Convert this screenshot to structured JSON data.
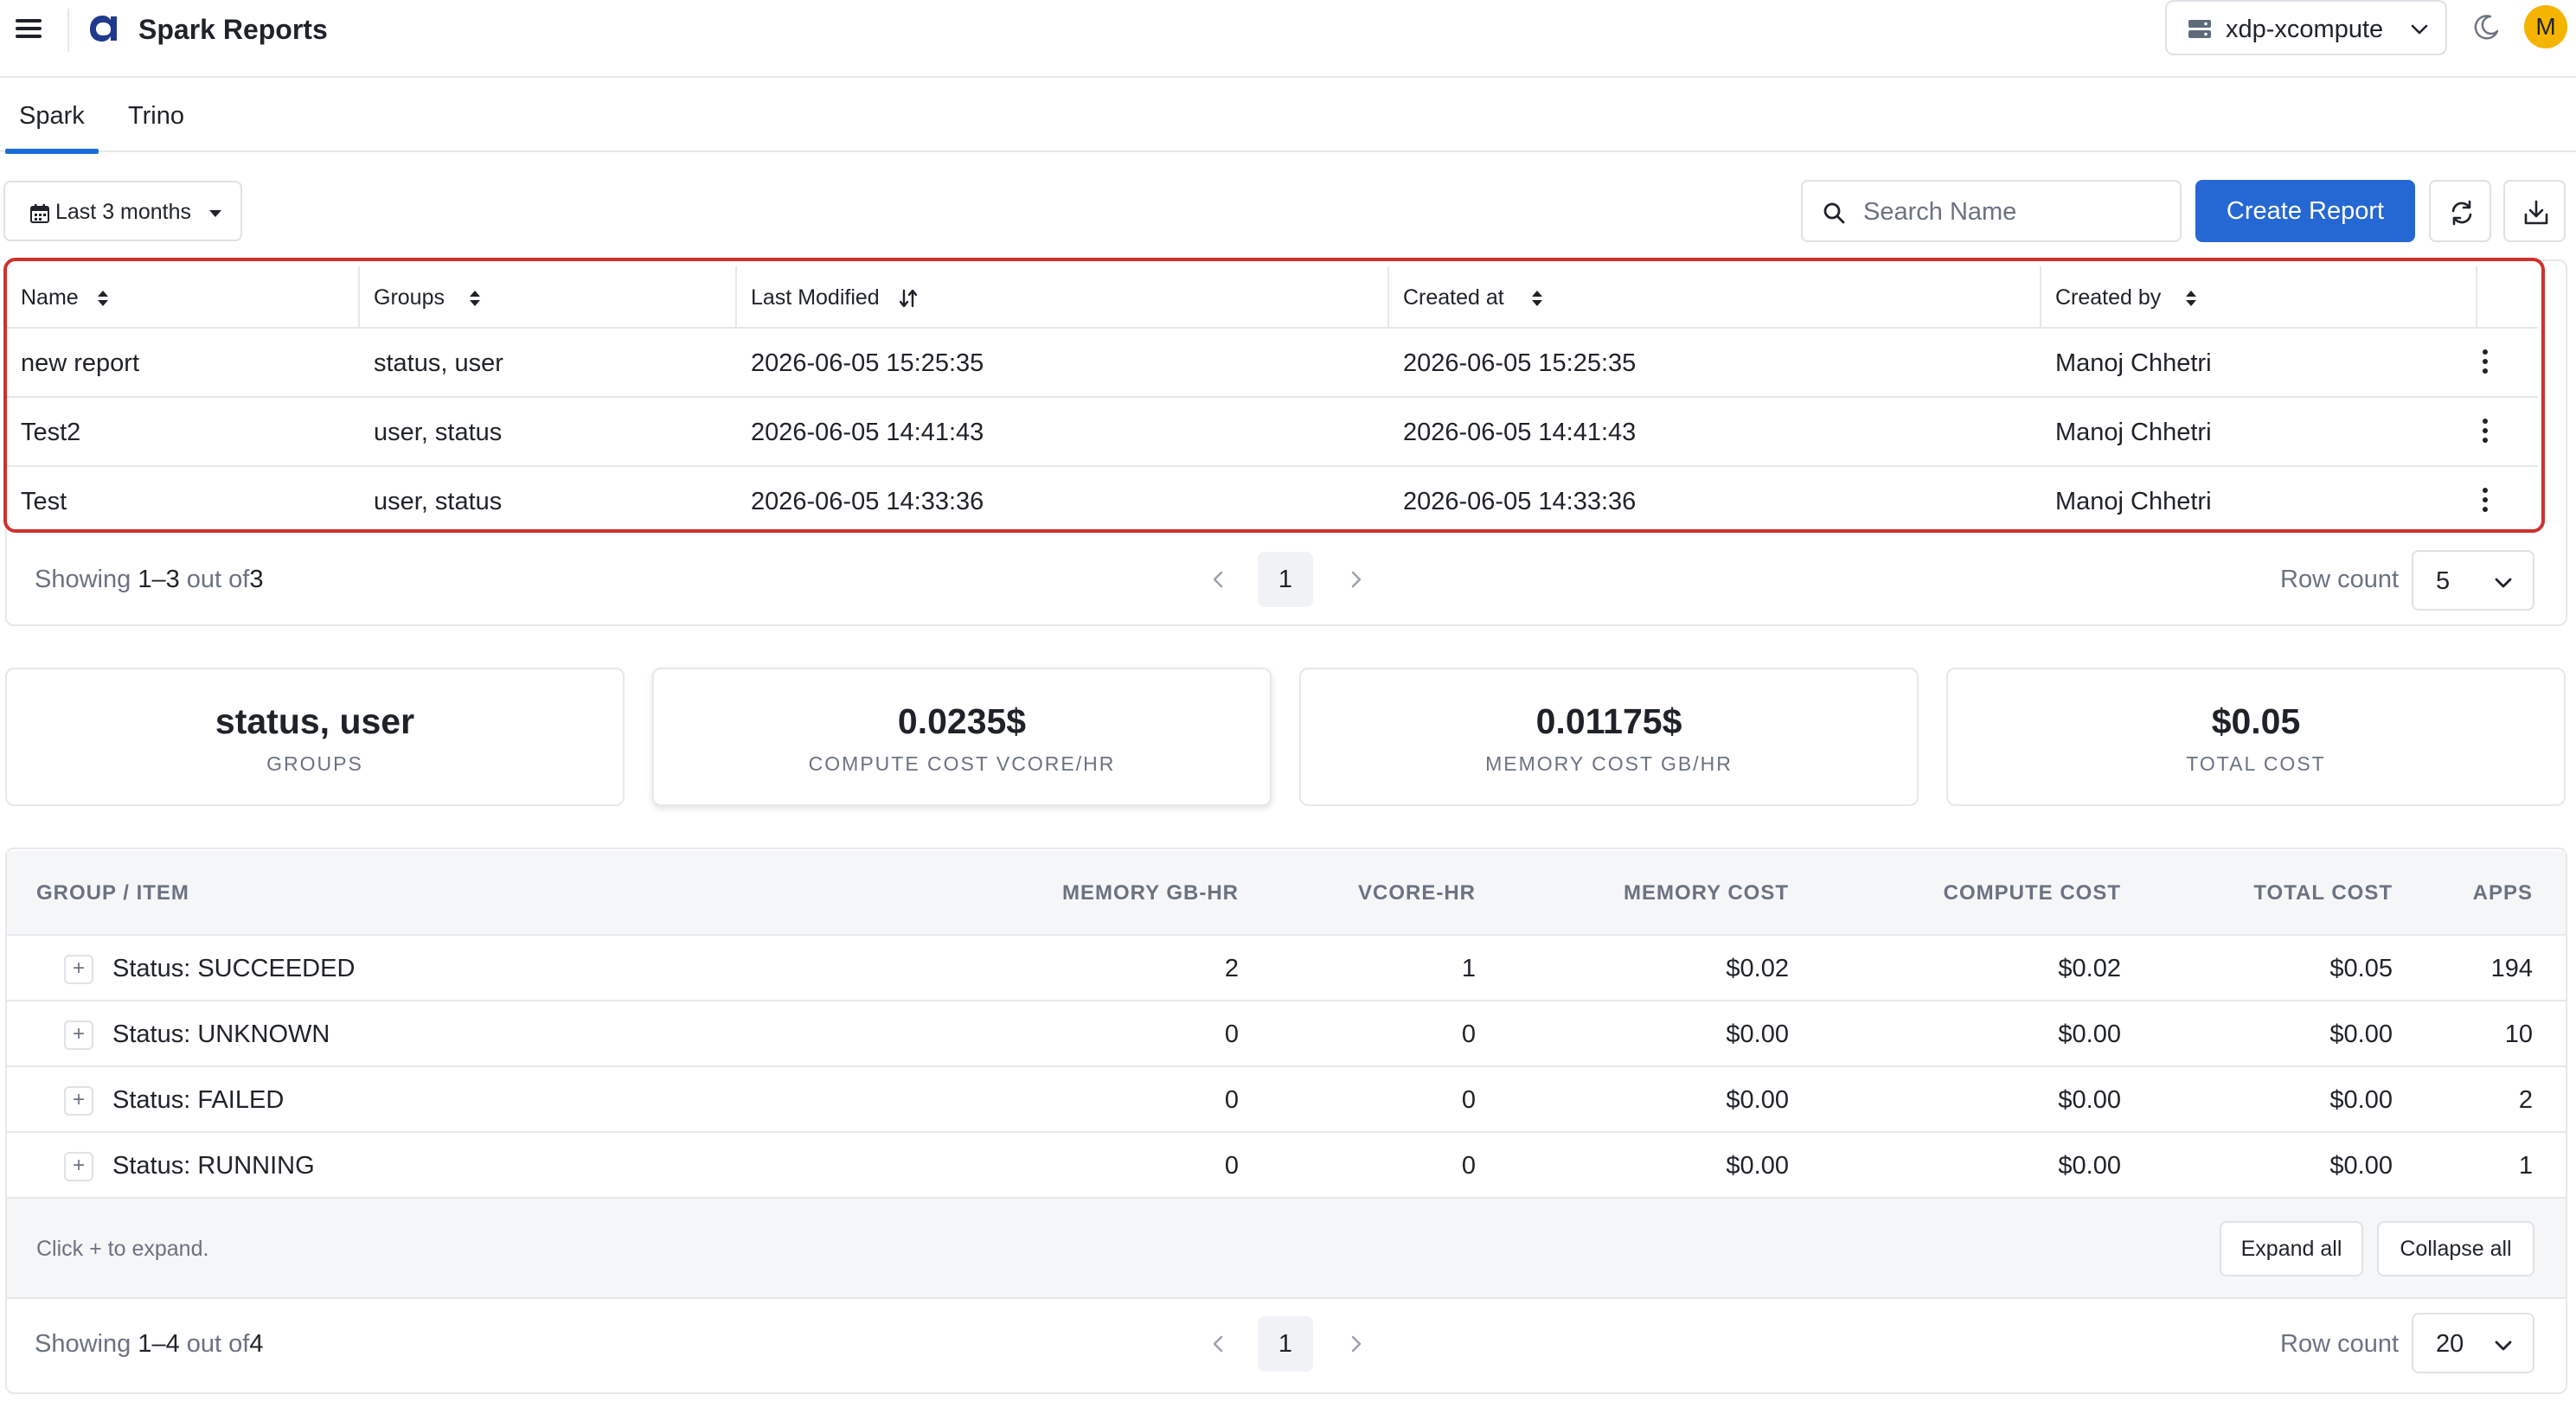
{
  "header": {
    "app_title": "Spark Reports",
    "cluster": "xdp-xcompute",
    "avatar_initial": "M",
    "brand_color": "#2568d3"
  },
  "tabs": [
    {
      "label": "Spark",
      "active": true
    },
    {
      "label": "Trino",
      "active": false
    }
  ],
  "toolbar": {
    "date_range": "Last 3 months",
    "search_placeholder": "Search Name",
    "create_label": "Create Report",
    "refresh_icon": "refresh-icon",
    "download_icon": "download-icon"
  },
  "reports": {
    "columns": [
      "Name",
      "Groups",
      "Last Modified",
      "Created at",
      "Created by"
    ],
    "rows": [
      {
        "name": "new report",
        "groups": "status, user",
        "last_modified": "2026-06-05 15:25:35",
        "created_at": "2026-06-05 15:25:35",
        "created_by": "Manoj Chhetri"
      },
      {
        "name": "Test2",
        "groups": "user, status",
        "last_modified": "2026-06-05 14:41:43",
        "created_at": "2026-06-05 14:41:43",
        "created_by": "Manoj Chhetri"
      },
      {
        "name": "Test",
        "groups": "user, status",
        "last_modified": "2026-06-05 14:33:36",
        "created_at": "2026-06-05 14:33:36",
        "created_by": "Manoj Chhetri"
      }
    ],
    "pager": {
      "showing": "Showing",
      "range": "1–3",
      "out_of": "out of",
      "total": "3",
      "page": "1",
      "row_count_label": "Row count",
      "row_count": "5"
    }
  },
  "summary": [
    {
      "value": "status, user",
      "label": "GROUPS"
    },
    {
      "value": "0.0235$",
      "label": "COMPUTE COST VCORE/HR"
    },
    {
      "value": "0.01175$",
      "label": "MEMORY COST GB/HR"
    },
    {
      "value": "$0.05",
      "label": "TOTAL COST"
    }
  ],
  "breakdown": {
    "columns": [
      "GROUP / ITEM",
      "MEMORY GB-HR",
      "VCORE-HR",
      "MEMORY COST",
      "COMPUTE COST",
      "TOTAL COST",
      "APPS"
    ],
    "rows": [
      {
        "group": "Status: SUCCEEDED",
        "memory_gb_hr": "2",
        "vcore_hr": "1",
        "memory_cost": "$0.02",
        "compute_cost": "$0.02",
        "total_cost": "$0.05",
        "apps": "194"
      },
      {
        "group": "Status: UNKNOWN",
        "memory_gb_hr": "0",
        "vcore_hr": "0",
        "memory_cost": "$0.00",
        "compute_cost": "$0.00",
        "total_cost": "$0.00",
        "apps": "10"
      },
      {
        "group": "Status: FAILED",
        "memory_gb_hr": "0",
        "vcore_hr": "0",
        "memory_cost": "$0.00",
        "compute_cost": "$0.00",
        "total_cost": "$0.00",
        "apps": "2"
      },
      {
        "group": "Status: RUNNING",
        "memory_gb_hr": "0",
        "vcore_hr": "0",
        "memory_cost": "$0.00",
        "compute_cost": "$0.00",
        "total_cost": "$0.00",
        "apps": "1"
      }
    ],
    "hint": "Click + to expand.",
    "expand_all": "Expand all",
    "collapse_all": "Collapse all",
    "expander_symbol": "+",
    "pager": {
      "showing": "Showing",
      "range": "1–4",
      "out_of": "out of",
      "total": "4",
      "page": "1",
      "row_count_label": "Row count",
      "row_count": "20"
    }
  }
}
